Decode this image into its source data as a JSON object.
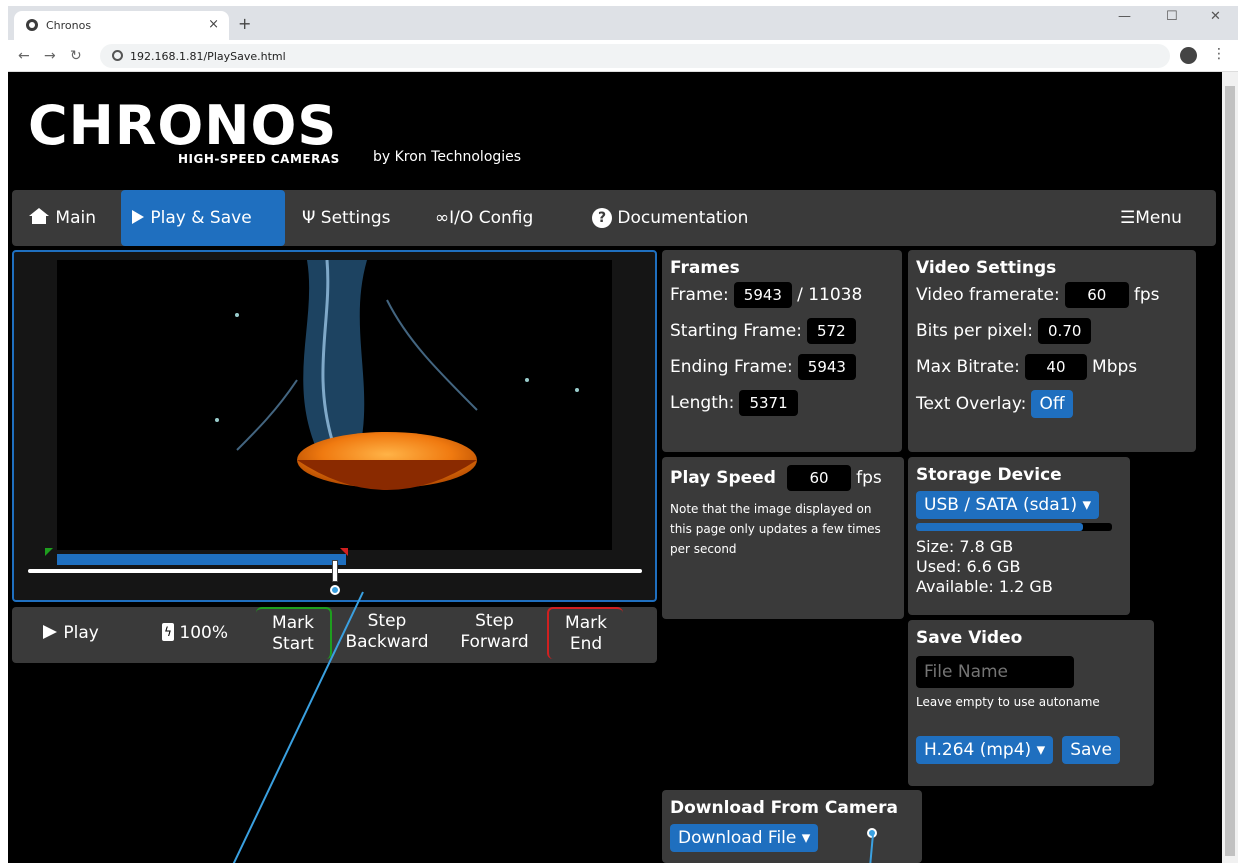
{
  "browser": {
    "tab_title": "Chronos",
    "tab_close": "×",
    "new_tab": "+",
    "url": "192.168.1.81/PlaySave.html",
    "minimize": "—",
    "maximize": "☐",
    "close": "✕"
  },
  "header": {
    "logo": "CHRONOS",
    "logo_sub": "HIGH-SPEED CAMERAS",
    "byline": "by Kron Technologies"
  },
  "nav": {
    "main": "Main",
    "play_save": "Play & Save",
    "settings": "Settings",
    "io_config": "I/O Config",
    "documentation": "Documentation",
    "menu": "Menu"
  },
  "controls": {
    "play": "Play",
    "battery": "100%",
    "mark_start_1": "Mark",
    "mark_start_2": "Start",
    "step_back_1": "Step",
    "step_back_2": "Backward",
    "step_fwd_1": "Step",
    "step_fwd_2": "Forward",
    "mark_end_1": "Mark",
    "mark_end_2": "End"
  },
  "playback": {
    "position_fraction": 0.5,
    "marked_start_fraction": 0.05,
    "marked_end_fraction": 0.52
  },
  "frames": {
    "title": "Frames",
    "frame_label": "Frame:",
    "frame_value": "5943",
    "frame_total": "/ 11038",
    "start_label": "Starting Frame:",
    "start_value": "572",
    "end_label": "Ending Frame:",
    "end_value": "5943",
    "length_label": "Length:",
    "length_value": "5371"
  },
  "play_speed": {
    "title": "Play Speed",
    "value": "60",
    "unit": "fps",
    "note": "Note that the image displayed on this page only updates a few times per second"
  },
  "video_settings": {
    "title": "Video Settings",
    "framerate_label": "Video framerate:",
    "framerate_value": "60",
    "framerate_unit": "fps",
    "bpp_label": "Bits per pixel:",
    "bpp_value": "0.70",
    "bitrate_label": "Max Bitrate:",
    "bitrate_value": "40",
    "bitrate_unit": "Mbps",
    "overlay_label": "Text Overlay:",
    "overlay_value": "Off"
  },
  "storage": {
    "title": "Storage Device",
    "device": "USB / SATA (sda1)",
    "used_fraction": 0.85,
    "size": "Size: 7.8 GB",
    "used": "Used: 6.6 GB",
    "available": "Available: 1.2 GB"
  },
  "save_video": {
    "title": "Save Video",
    "filename_placeholder": "File Name",
    "hint": "Leave empty to use autoname",
    "format": "H.264 (mp4)",
    "save": "Save"
  },
  "download": {
    "title": "Download From Camera",
    "button": "Download File"
  },
  "colors": {
    "accent": "#1f6fbf",
    "panel": "#3a3a3a",
    "mark_start": "#1e9e1e",
    "mark_end": "#d02020"
  }
}
